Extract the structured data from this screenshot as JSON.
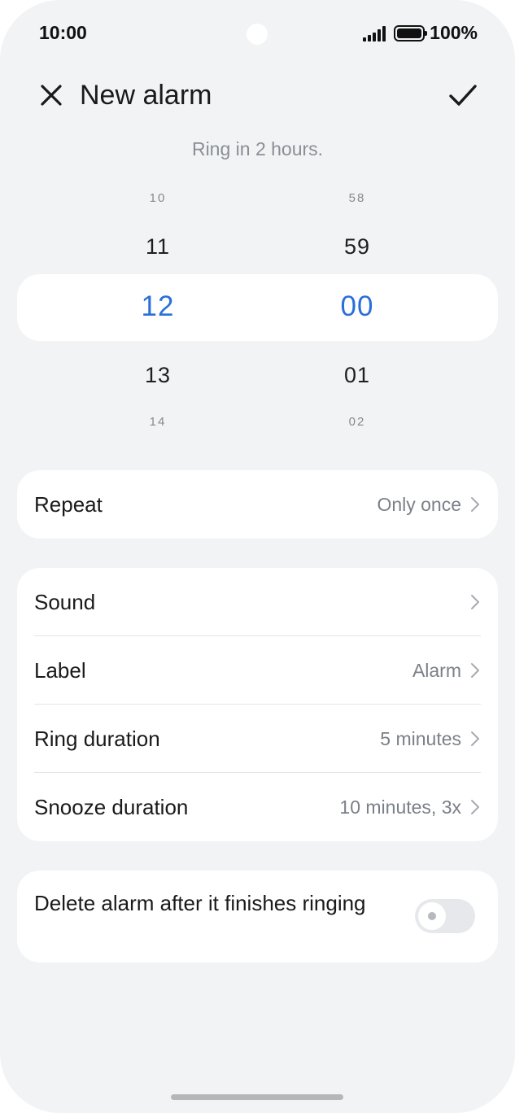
{
  "status_bar": {
    "time": "10:00",
    "battery": "100%"
  },
  "header": {
    "title": "New alarm",
    "subtitle": "Ring in 2 hours."
  },
  "picker": {
    "hours": {
      "far_above": "10",
      "above": "11",
      "selected": "12",
      "below": "13",
      "far_below": "14"
    },
    "minutes": {
      "far_above": "58",
      "above": "59",
      "selected": "00",
      "below": "01",
      "far_below": "02"
    },
    "accent_color": "#2a6fd9"
  },
  "repeat": {
    "label": "Repeat",
    "value": "Only once"
  },
  "settings": {
    "sound": {
      "label": "Sound",
      "value": ""
    },
    "label": {
      "label": "Label",
      "value": "Alarm"
    },
    "ring_duration": {
      "label": "Ring duration",
      "value": "5 minutes"
    },
    "snooze_duration": {
      "label": "Snooze duration",
      "value": "10 minutes, 3x"
    }
  },
  "delete_after": {
    "label": "Delete alarm after it finishes ringing",
    "enabled": false
  },
  "icons": {
    "close": "close-icon",
    "confirm": "check-icon",
    "chevron": "chevron-right-icon"
  }
}
